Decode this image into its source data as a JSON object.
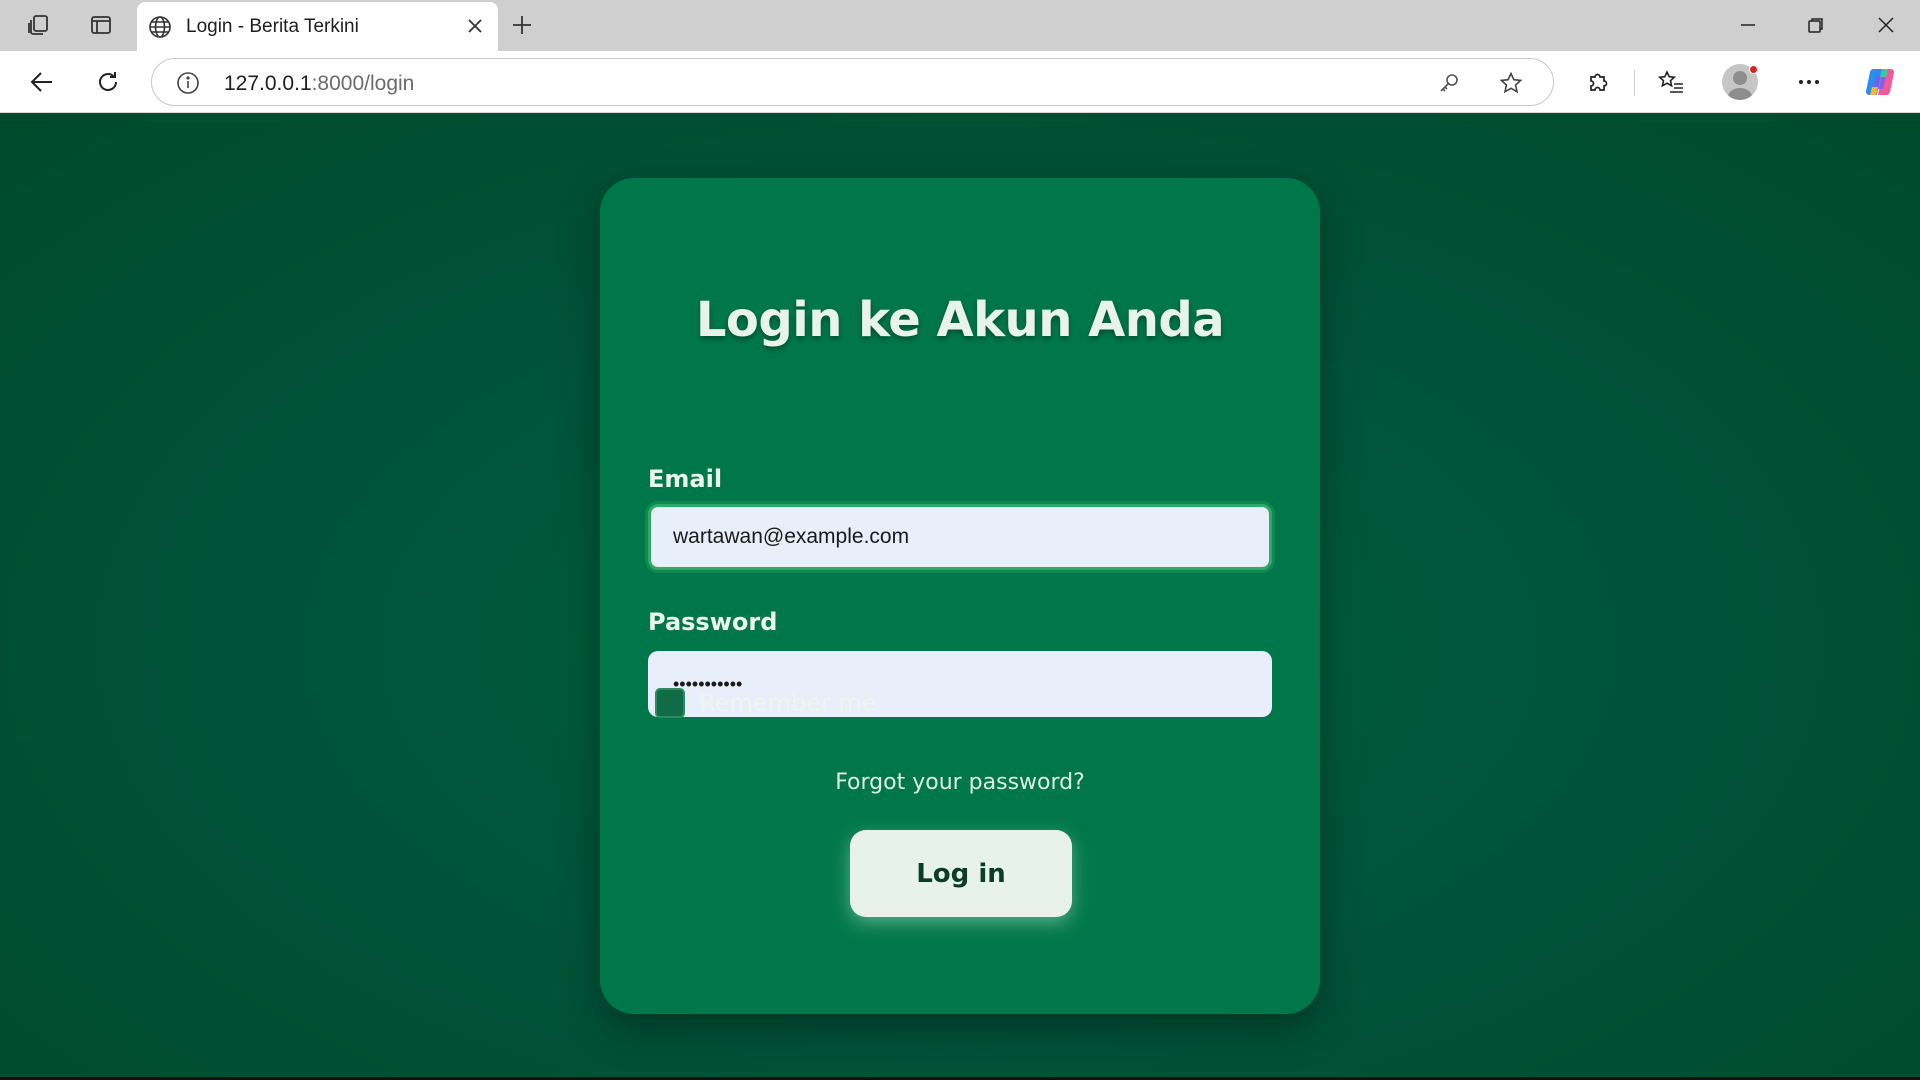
{
  "browser": {
    "tab": {
      "title": "Login - Berita Terkini"
    },
    "address": {
      "host": "127.0.0.1",
      "path": ":8000/login"
    },
    "icons": {
      "workspaces": "workspaces-icon",
      "tab_actions": "tab-actions-icon",
      "favicon": "globe-icon",
      "close_tab": "close-icon",
      "new_tab": "plus-icon",
      "back": "back-arrow-icon",
      "refresh": "refresh-icon",
      "site_info": "info-icon",
      "password_key": "key-icon",
      "favorite": "star-icon",
      "extensions": "puzzle-icon",
      "favorites_list": "favorites-icon",
      "profile": "profile-icon",
      "more": "more-icon",
      "copilot": "copilot-icon",
      "minimize": "minimize-icon",
      "restore": "restore-icon",
      "close_window": "close-window-icon"
    }
  },
  "login": {
    "title": "Login ke Akun Anda",
    "email_label": "Email",
    "email_value": "wartawan@example.com",
    "password_label": "Password",
    "password_value": "•••••••••••",
    "remember_label": "Remember me",
    "remember_checked": false,
    "forgot_link": "Forgot your password?",
    "submit_label": "Log in"
  },
  "colors": {
    "page_background": "#004d30",
    "card_background": "#00774a",
    "input_background": "#e8eefa",
    "focus_ring": "#2eaa66",
    "button_background": "#e7f3ea",
    "button_text": "#0d3d26"
  }
}
